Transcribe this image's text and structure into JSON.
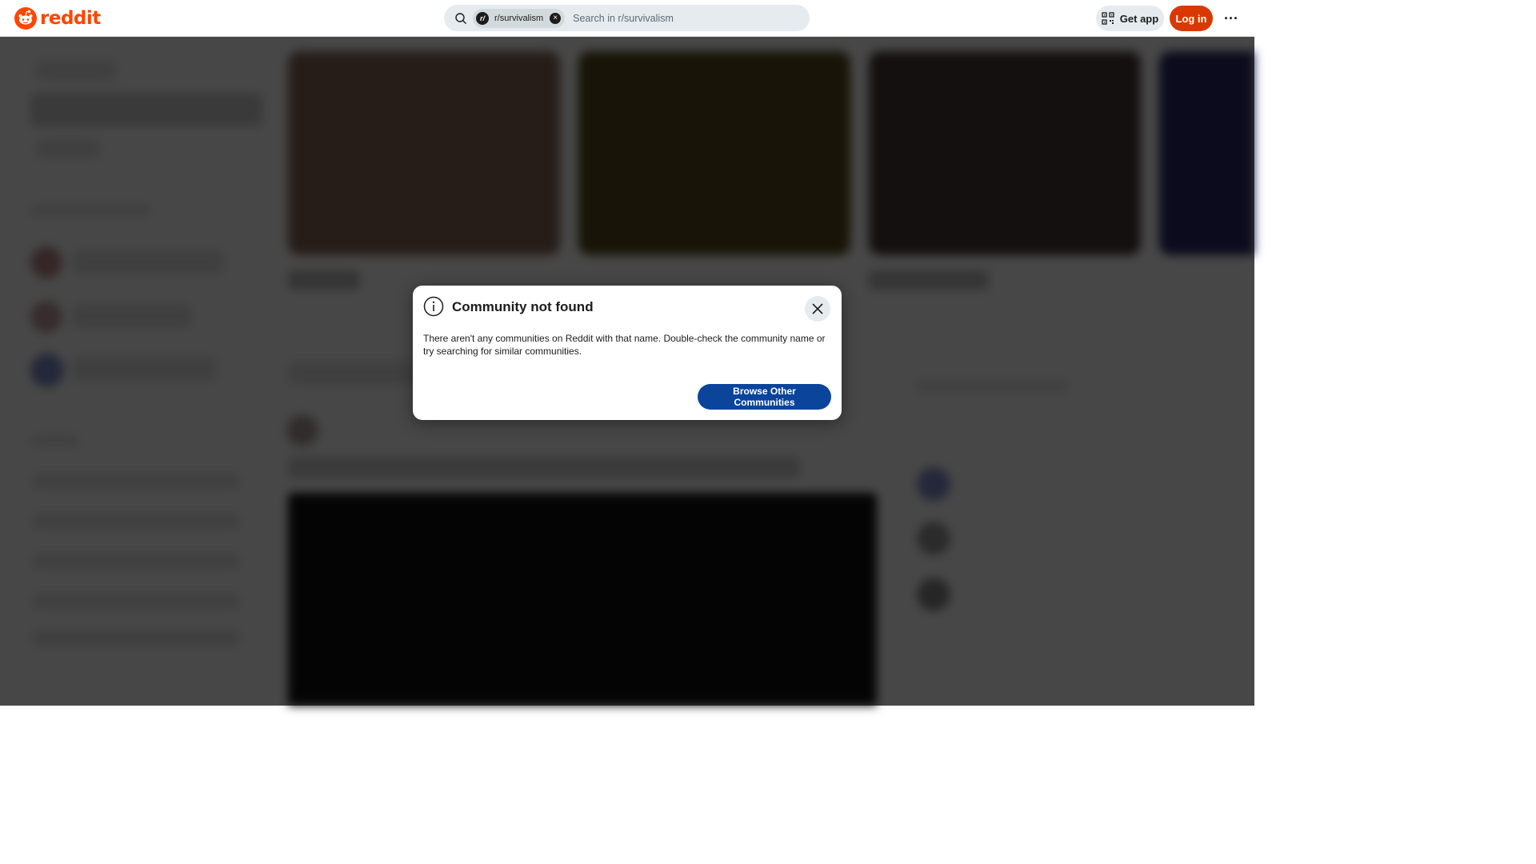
{
  "header": {
    "brand": "reddit",
    "search_chip_label": "r/survivalism",
    "search_chip_avatar_letter": "r/",
    "search_placeholder": "Search in r/survivalism",
    "get_app_label": "Get app",
    "login_label": "Log in",
    "more_label": "···"
  },
  "modal": {
    "title": "Community not found",
    "body": "There aren't any communities on Reddit with that name. Double-check the community name or try searching for similar communities.",
    "primary_button": "Browse Other Communities"
  },
  "colors": {
    "brand_orange": "#ff4500",
    "login_button": "#d93900",
    "primary_button": "#0a449b",
    "search_bg": "#e5ebee"
  },
  "icons": [
    "reddit-logo-icon",
    "search-icon",
    "chip-close-icon",
    "qr-code-icon",
    "more-icon",
    "info-icon",
    "close-icon"
  ]
}
